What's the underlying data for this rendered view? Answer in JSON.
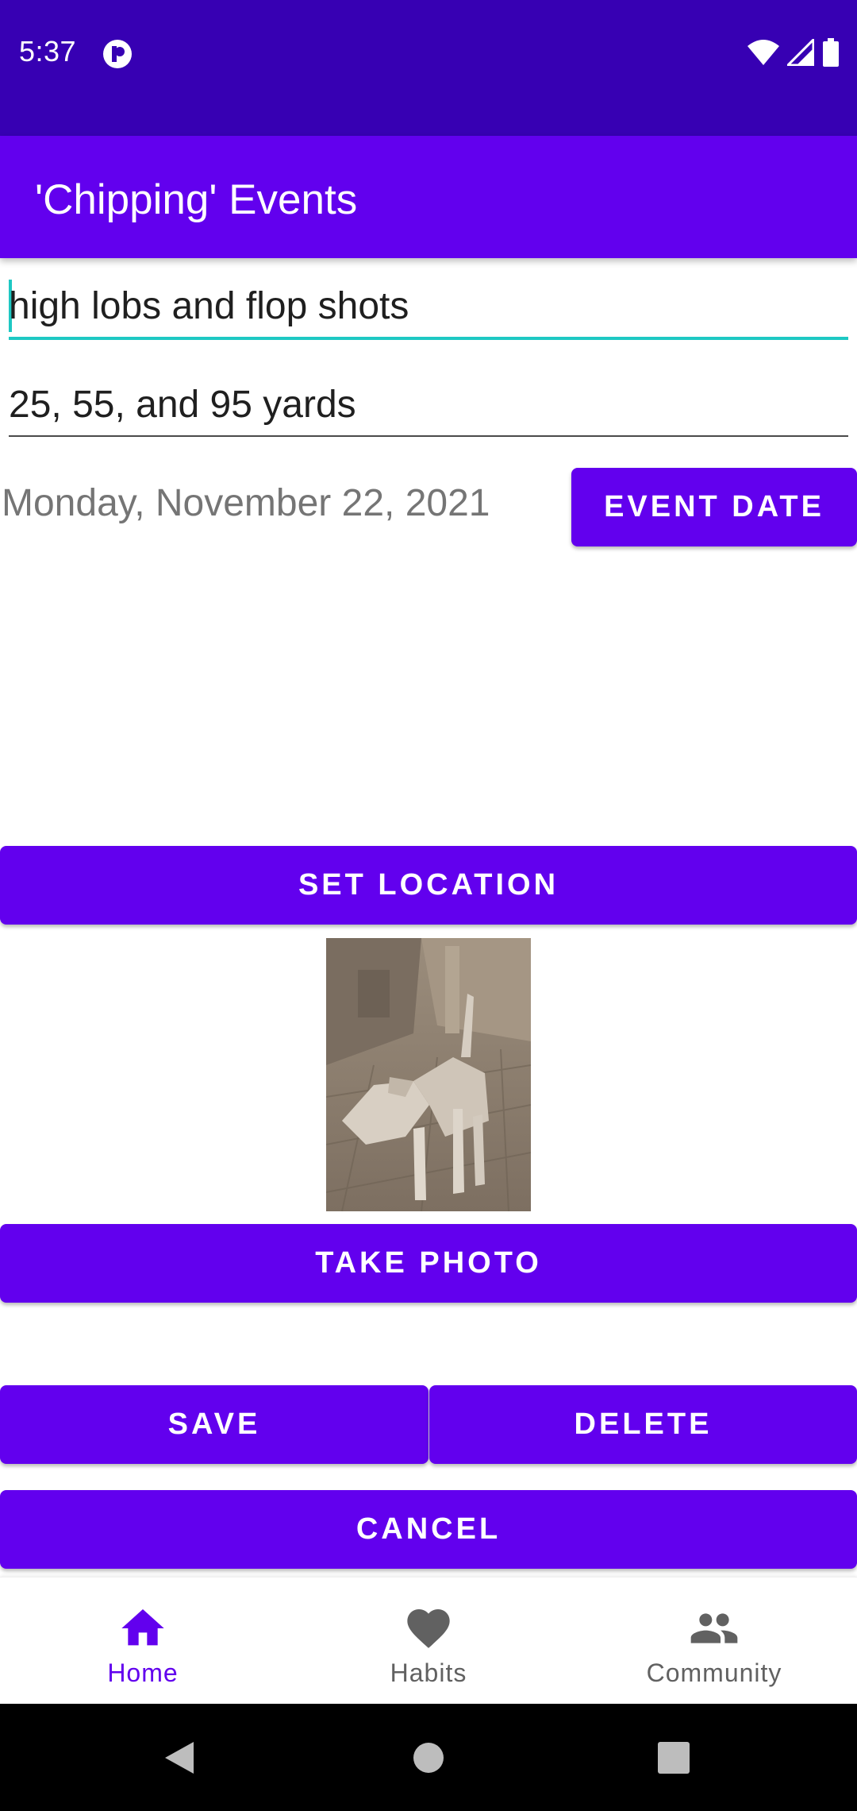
{
  "status_bar": {
    "time": "5:37",
    "icons": [
      "app-notification-icon",
      "wifi-icon",
      "signal-icon",
      "battery-icon"
    ]
  },
  "app_bar": {
    "title": "'Chipping' Events"
  },
  "form": {
    "title_value": "high lobs and flop shots",
    "details_value": "25, 55, and 95 yards",
    "date_text": "Monday, November 22, 2021",
    "event_date_label": "EVENT DATE",
    "set_location_label": "SET LOCATION",
    "take_photo_label": "TAKE PHOTO",
    "save_label": "SAVE",
    "delete_label": "DELETE",
    "cancel_label": "CANCEL"
  },
  "bottom_nav": {
    "items": [
      {
        "label": "Home",
        "icon": "home-icon",
        "active": true
      },
      {
        "label": "Habits",
        "icon": "heart-icon",
        "active": false
      },
      {
        "label": "Community",
        "icon": "people-icon",
        "active": false
      }
    ]
  },
  "system_nav": {
    "icons": [
      "back-icon",
      "home-circle-icon",
      "recents-icon"
    ]
  },
  "colors": {
    "primary": "#6200ee",
    "primary_dark": "#3700b3",
    "accent": "#1ec8c3"
  }
}
